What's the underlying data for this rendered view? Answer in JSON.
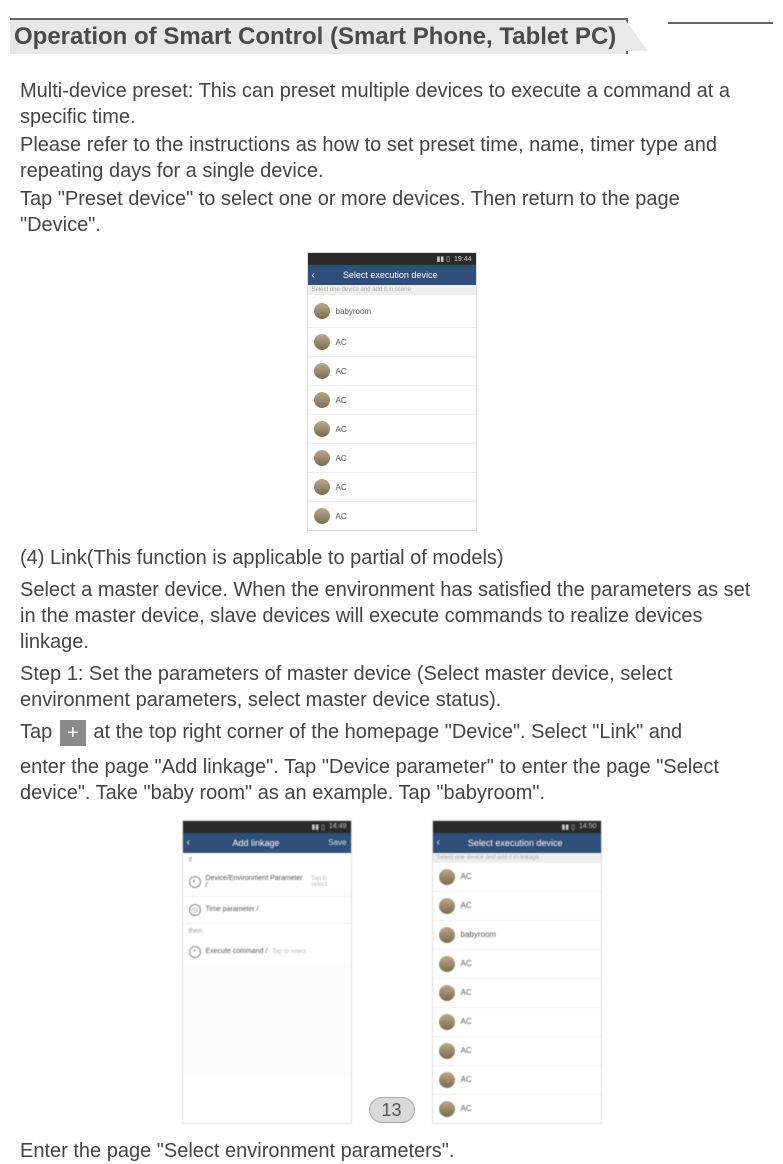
{
  "title": "Operation of Smart Control (Smart Phone, Tablet PC)",
  "p1": "Multi-device preset: This can preset multiple devices to execute a command at a specific time.",
  "p2": "Please refer to the instructions as how to set preset time, name, timer type and repeating days for a single device.",
  "p3": "Tap \"Preset device\" to select one or more devices. Then return to the page \"Device\".",
  "screenshot1": {
    "time": "19:44",
    "header": "Select execution device",
    "sub": "Select one device and add it in scene",
    "items": [
      "babyroom",
      "AC",
      "AC",
      "AC",
      "AC",
      "AC",
      "AC",
      "AC"
    ]
  },
  "p4": "(4) Link(This function is applicable to partial of models)",
  "p5": "Select a master device. When the environment has satisfied the parameters as set in the master device, slave devices will execute commands to realize devices linkage.",
  "p6": "Step 1: Set the parameters of master device (Select master device, select environment parameters, select master device status).",
  "p7a": "Tap ",
  "p7b": " at the top right corner of the homepage \"Device\". Select \"Link\" and",
  "p8": "enter the page \"Add linkage\". Tap \"Device parameter\" to enter the page \"Select device\". Take \"baby room\" as an example. Tap \"babyroom\".",
  "screenshot2": {
    "time": "14:49",
    "header": "Add linkage",
    "save": "Save",
    "if": "if",
    "row1": "Device/Environment Parameter /",
    "row1hint": "Tap to select",
    "row2": "Time parameter /",
    "then": "then",
    "row3": "Execute command /",
    "row3hint": "Tap to select"
  },
  "screenshot3": {
    "time": "14:50",
    "header": "Select execution device",
    "sub": "Select one device and add it in linkage",
    "items": [
      "AC",
      "AC",
      "babyroom",
      "AC",
      "AC",
      "AC",
      "AC",
      "AC",
      "AC"
    ]
  },
  "p9": "Enter the page \"Select environment parameters\".",
  "pageNumber": "13",
  "plusSymbol": "+"
}
